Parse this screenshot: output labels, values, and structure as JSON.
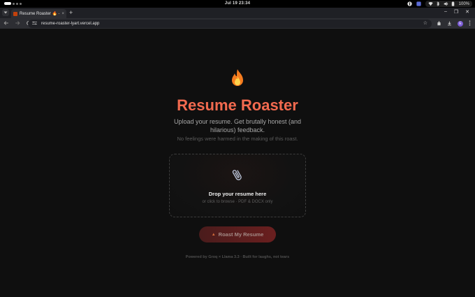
{
  "system": {
    "clock": "Jul 19  23:34",
    "battery_pct": "100%"
  },
  "browser": {
    "tab_title": "Resume Roaster 🔥 — ",
    "tab_close": "×",
    "new_tab": "+",
    "url": "resume-roaster-lyart.vercel.app",
    "profile_initial": "E",
    "window_controls": [
      "–",
      "❐",
      "✕"
    ]
  },
  "page": {
    "emoji_icon": "fire-icon",
    "title": "Resume Roaster",
    "subtitle": "Upload your resume. Get brutally honest (and hilarious) feedback.",
    "tagline": "No feelings were harmed in the making of this roast.",
    "dropzone": {
      "icon": "paperclip-icon",
      "title": "Drop your resume here",
      "hint": "or click to browse · PDF & DOCX only"
    },
    "button_label": "Roast My Resume",
    "footer": "Powered by Groq × Llama 3.3 · Built for laughs, not tears"
  },
  "colors": {
    "accent": "#f26a4f",
    "button_bg": "#5a1e1e",
    "background": "#0f0f0f"
  }
}
